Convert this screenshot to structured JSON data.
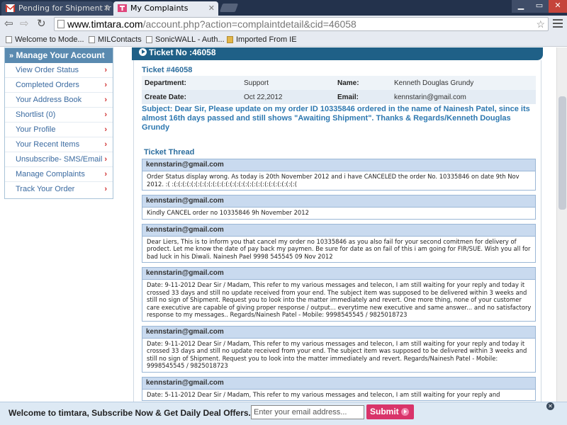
{
  "browser": {
    "tabs": [
      {
        "label": "Pending for Shipment fr",
        "active": false
      },
      {
        "label": "My Complaints",
        "active": true
      }
    ],
    "url_domain": "www.timtara.com",
    "url_path": "/account.php?action=complaintdetail&cid=46058",
    "bookmarks": [
      {
        "label": "Welcome to Mode..."
      },
      {
        "label": "MILContacts"
      },
      {
        "label": "SonicWALL - Auth..."
      },
      {
        "label": "Imported From IE"
      }
    ]
  },
  "sidebar": {
    "title": "Manage Your Account",
    "items": [
      {
        "label": "View Order Status"
      },
      {
        "label": "Completed Orders"
      },
      {
        "label": "Your Address Book"
      },
      {
        "label": "Shortlist (0)"
      },
      {
        "label": "Your Profile"
      },
      {
        "label": "Your Recent Items"
      },
      {
        "label": "Unsubscribe- SMS/Email"
      },
      {
        "label": "Manage Complaints"
      },
      {
        "label": "Track Your Order"
      }
    ],
    "chevron": "›"
  },
  "ticket": {
    "header": "Ticket No :46058",
    "title": "Ticket #46058",
    "department_label": "Department:",
    "department": "Support",
    "name_label": "Name:",
    "name": "Kenneth Douglas Grundy",
    "create_date_label": "Create Date:",
    "create_date": "Oct 22,2012",
    "email_label": "Email:",
    "email": "kennstarin@gmail.com",
    "subject": "Subject: Dear Sir, Please update on my order ID 10335846 ordered in the name of Nainesh Patel, since its almost 16th days passed and still shows \"Awaiting Shipment\". Thanks & Regards/Kenneth Douglas Grundy"
  },
  "thread": {
    "title": "Ticket Thread",
    "messages": [
      {
        "author": "kennstarin@gmail.com",
        "body": "Order Status display wrong. As today is 20th November 2012 and i have CANCELED the order No. 10335846 on date 9th Nov 2012. :( :(:(:(:(:(:(:(:(:(:(:(:(:(:(:(:(:(:(:(:(:(:(:(:(:(:(:(:(:("
      },
      {
        "author": "kennstarin@gmail.com",
        "body": "Kindly CANCEL order no 10335846 9h November 2012"
      },
      {
        "author": "kennstarin@gmail.com",
        "body": "Dear Liers, This is to inform you that cancel my order no 10335846 as you also fail for your second comitmen for delivery of prodect. Let me know the date of pay back my paymen. Be sure for date as on fail of this i am going for FIR/SUE. Wish you all for bad luck in his Diwali. Nainesh Pael 9998 545545 09 Nov 2012"
      },
      {
        "author": "kennstarin@gmail.com",
        "body": "Date: 9-11-2012 Dear Sir / Madam, This refer to my various messages and telecon, I am still waiting for your reply and today it crossed 33 days and still no update received from your end. The subject item was supposed to be delivered within 3 weeks and still no sign of Shipment. Request you to look into the matter immediately and revert. One more thing, none of your customer care executive are capable of giving proper response / output... everytime new executive and same answer... and no satisfactory response to my messages.. Regards/Nainesh Patel - Mobile: 9998545545 / 9825018723"
      },
      {
        "author": "kennstarin@gmail.com",
        "body": "Date: 9-11-2012 Dear Sir / Madam, This refer to my various messages and telecon, I am still waiting for your reply and today it crossed 33 days and still no update received from your end. The subject item was supposed to be delivered within 3 weeks and still no sign of Shipment. Request you to look into the matter immediately and revert. Regards/Nainesh Patel - Mobile: 9998545545 / 9825018723"
      },
      {
        "author": "kennstarin@gmail.com",
        "body": "Date: 5-11-2012 Dear Sir / Madam, This refer to my various messages and telecon, I am still waiting for your reply and"
      }
    ]
  },
  "subscribe": {
    "text": "Welcome to timtara, Subscribe Now & Get Daily Deal Offers.",
    "placeholder": "Enter your email address...",
    "button": "Submit"
  },
  "icons": {
    "tab1_favicon": "gmail-icon",
    "tab2_favicon": "timtara-icon",
    "back": "back-arrow-icon",
    "forward": "forward-arrow-icon",
    "reload": "reload-icon",
    "star": "star-icon",
    "menu": "menu-icon"
  },
  "colors": {
    "sidebar_header": "#5a8ab0",
    "ticket_bar": "#1f6087",
    "subject_text": "#2d78b0",
    "message_header": "#c9daef",
    "submit_button": "#d9346a"
  }
}
